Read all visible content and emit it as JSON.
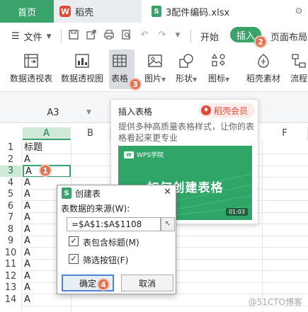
{
  "titlebar": {
    "home_tab": "首页",
    "app_tab": "稻壳",
    "file_tab": "3配件编码.xlsx",
    "app_logo": "W",
    "file_logo": "S",
    "window_control": "⊙"
  },
  "menubar": {
    "file_menu": "文件",
    "tabs": [
      {
        "label": "开始"
      },
      {
        "label": "插入"
      },
      {
        "label": "页面布局"
      }
    ]
  },
  "ribbon": {
    "items": [
      {
        "label": "数据透视表"
      },
      {
        "label": "数据透视图"
      },
      {
        "label": "表格"
      },
      {
        "label": "图片"
      },
      {
        "label": "形状"
      },
      {
        "label": "图标"
      },
      {
        "label": "稻壳素材"
      },
      {
        "label": "流程"
      }
    ]
  },
  "formula_bar": {
    "cell_ref": "A3"
  },
  "grid": {
    "columns": [
      "A",
      "B",
      "F"
    ],
    "rows": [
      "1",
      "2",
      "3",
      "4",
      "5",
      "6",
      "7",
      "8",
      "9",
      "10",
      "11",
      "12",
      "13",
      "14"
    ],
    "col_a_values": [
      "标题",
      "A",
      "A",
      "A",
      "A",
      "A",
      "A",
      "A",
      "A",
      "A",
      "A",
      "A",
      "A",
      "A"
    ]
  },
  "popup": {
    "title": "插入表格",
    "badge": "稻壳会员",
    "description": "提供多种高质量表格样式，让你的表格看起来更专业",
    "promo_brand": "WPS学院",
    "promo_title": "如何创建表格",
    "promo_time": "01:03"
  },
  "dialog": {
    "title": "创建表",
    "close": "✕",
    "source_label": "表数据的来源(W):",
    "source_value": "=$A$1:$A$1108",
    "checkbox_header": "表包含标题(M)",
    "checkbox_filter": "筛选按钮(F)",
    "ok": "确定",
    "cancel": "取消"
  },
  "steps": [
    "1",
    "2",
    "3",
    "4"
  ],
  "watermark": "@51CTO博客",
  "colors": {
    "accent": "#3aa36b",
    "step_marker": "#e07152",
    "brand_red": "#e04a3a"
  }
}
